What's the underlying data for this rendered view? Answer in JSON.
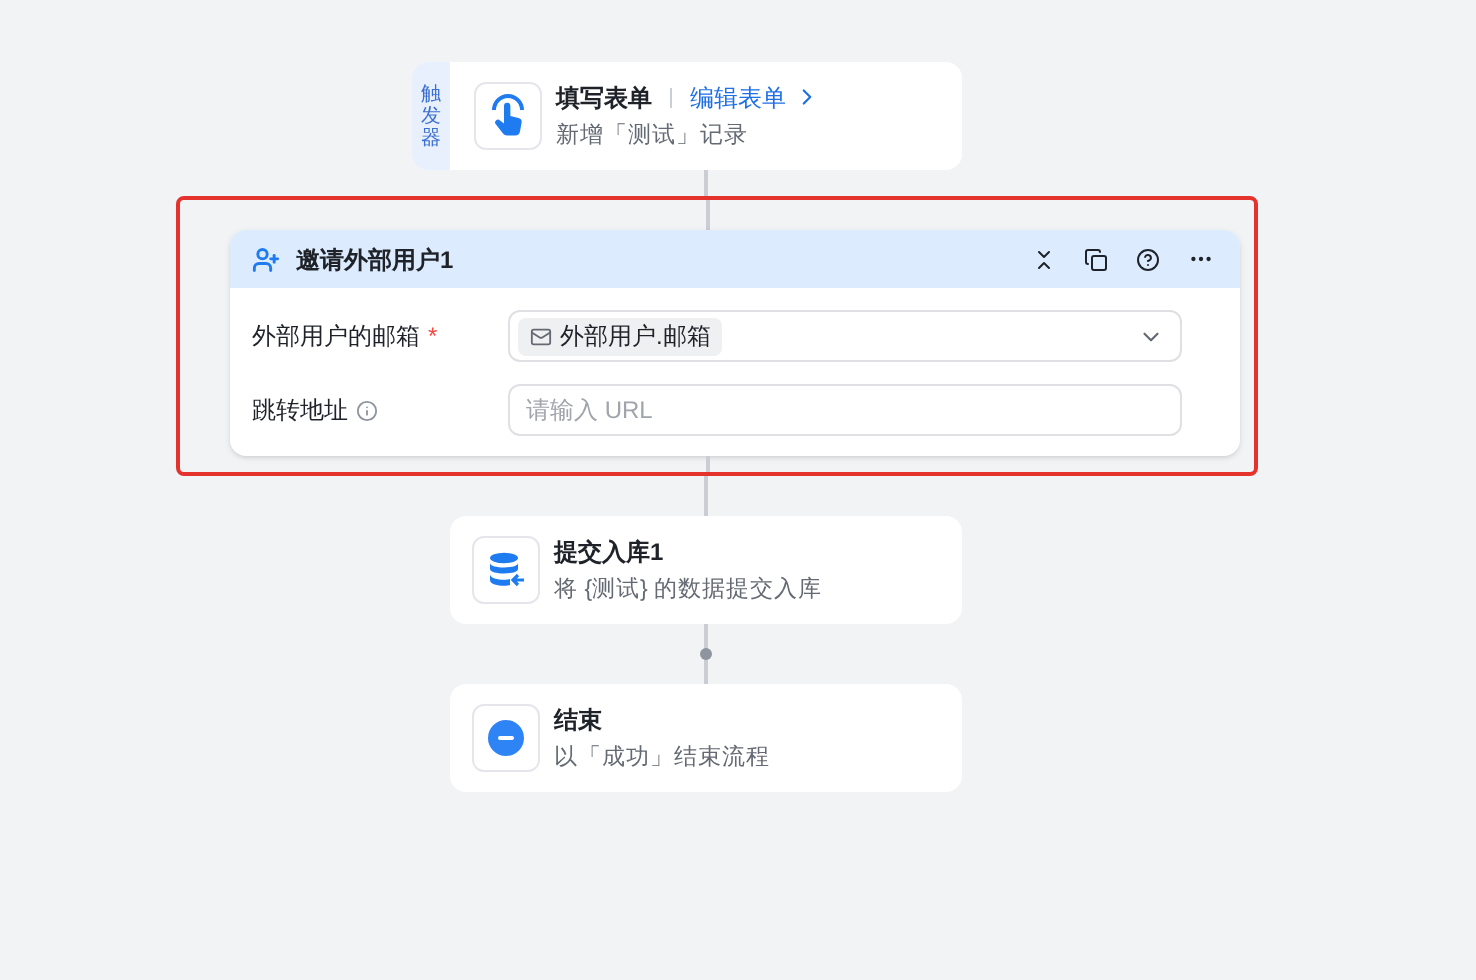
{
  "trigger": {
    "badge": "触发器",
    "title": "填写表单",
    "link": "编辑表单",
    "subtitle": "新增「测试」记录"
  },
  "action": {
    "title": "邀请外部用户1",
    "highlighted": true,
    "fields": [
      {
        "kind": "select",
        "label": "外部用户的邮箱",
        "required_mark": "*",
        "info": false,
        "token": "外部用户.邮箱"
      },
      {
        "kind": "input",
        "label": "跳转地址",
        "info": true,
        "placeholder": "请输入 URL"
      }
    ]
  },
  "nodes": [
    {
      "kind": "database",
      "title": "提交入库1",
      "subtitle": "将 {测试} 的数据提交入库"
    },
    {
      "kind": "end",
      "title": "结束",
      "subtitle": "以「成功」结束流程"
    }
  ]
}
